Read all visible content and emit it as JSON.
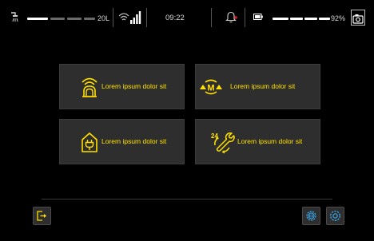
{
  "status": {
    "water_level": "20L",
    "time": "09:22",
    "battery_percent": "92%",
    "water_fill": 0.3,
    "battery_fill": 0.92,
    "signal_bars": 4
  },
  "tiles": [
    {
      "label": "Lorem ipsum dolor sit",
      "icon": "tunnel-signal-icon"
    },
    {
      "label": "Lorem ipsum dolor sit",
      "icon": "manual-cycle-icon"
    },
    {
      "label": "Lorem ipsum dolor sit",
      "icon": "house-plug-icon"
    },
    {
      "label": "Lorem ipsum dolor sit",
      "icon": "24h-service-icon"
    }
  ],
  "colors": {
    "accent": "#ffe000",
    "alert": "#e02020",
    "cool": "#3aa0e0",
    "tile_bg": "#2e2e2e"
  }
}
